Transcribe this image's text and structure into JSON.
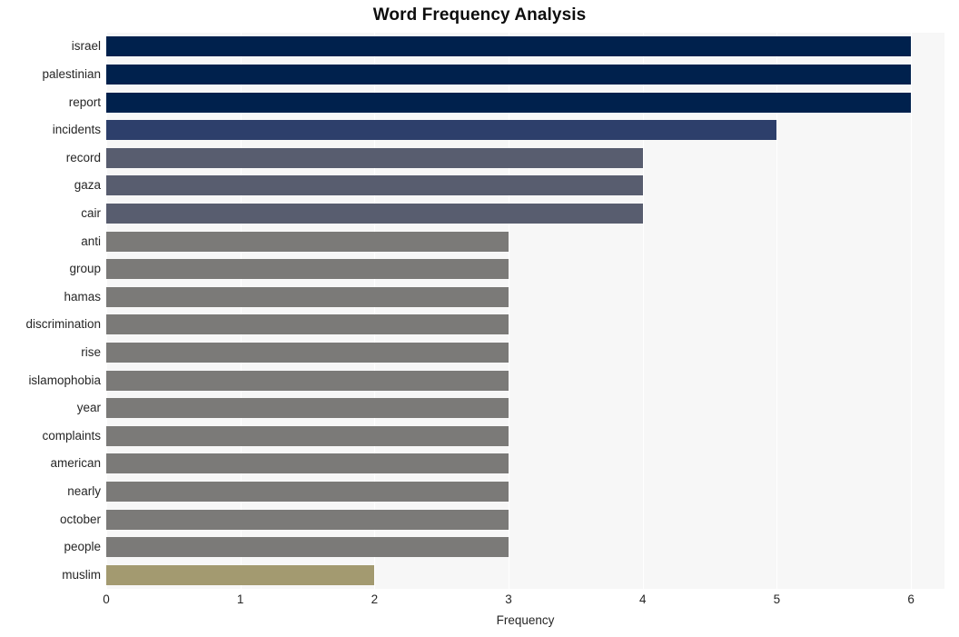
{
  "chart_data": {
    "type": "bar",
    "orientation": "horizontal",
    "title": "Word Frequency Analysis",
    "xlabel": "Frequency",
    "ylabel": "",
    "xlim": [
      0,
      6.25
    ],
    "xticks": [
      0,
      1,
      2,
      3,
      4,
      5,
      6
    ],
    "xtick_labels": [
      "0",
      "1",
      "2",
      "3",
      "4",
      "5",
      "6"
    ],
    "grid": "vertical-white-on-light-gray",
    "legend": "none",
    "categories": [
      "israel",
      "palestinian",
      "report",
      "incidents",
      "record",
      "gaza",
      "cair",
      "anti",
      "group",
      "hamas",
      "discrimination",
      "rise",
      "islamophobia",
      "year",
      "complaints",
      "american",
      "nearly",
      "october",
      "people",
      "muslim"
    ],
    "values": [
      6,
      6,
      6,
      5,
      4,
      4,
      4,
      3,
      3,
      3,
      3,
      3,
      3,
      3,
      3,
      3,
      3,
      3,
      3,
      2
    ],
    "bar_colors": [
      "#00214d",
      "#00214d",
      "#00214d",
      "#2d3f6b",
      "#585d6f",
      "#585d6f",
      "#585d6f",
      "#7b7a78",
      "#7b7a78",
      "#7b7a78",
      "#7b7a78",
      "#7b7a78",
      "#7b7a78",
      "#7b7a78",
      "#7b7a78",
      "#7b7a78",
      "#7b7a78",
      "#7b7a78",
      "#7b7a78",
      "#a39a70"
    ],
    "colors": {
      "plot_background": "#f7f7f7",
      "figure_background": "#ffffff",
      "gridline": "#ffffff",
      "tick_text": "#262626",
      "title_text": "#0d0d0d"
    }
  }
}
